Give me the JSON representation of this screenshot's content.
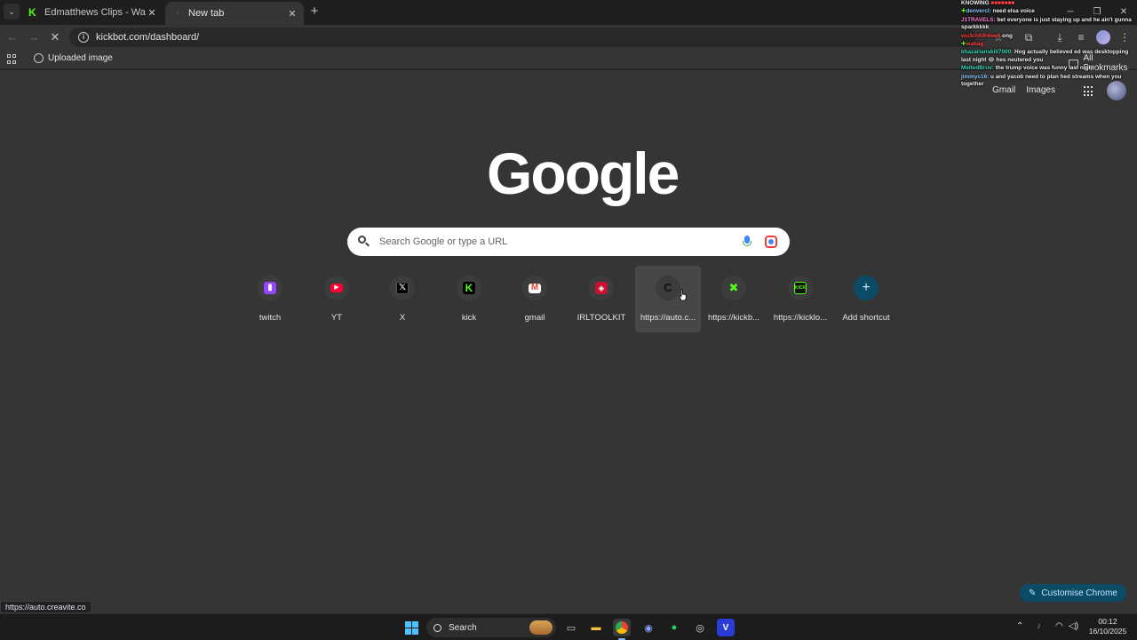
{
  "tabs": [
    {
      "title": "Edmatthews Clips - Watch Live",
      "active": false
    },
    {
      "title": "New tab",
      "active": true
    }
  ],
  "omnibox": {
    "url": "kickbot.com/dashboard/"
  },
  "bookmarks": {
    "items": [
      {
        "label": "Uploaded image"
      }
    ],
    "all_bookmarks": "All Bookmarks"
  },
  "ntp": {
    "links": [
      "Gmail",
      "Images"
    ],
    "logo_text": "Google",
    "search_placeholder": "Search Google or type a URL",
    "shortcuts": [
      {
        "label": "twitch",
        "icon": "twitch-icon"
      },
      {
        "label": "YT",
        "icon": "youtube-icon"
      },
      {
        "label": "X",
        "icon": "x-icon"
      },
      {
        "label": "kick",
        "icon": "kick-icon"
      },
      {
        "label": "gmail",
        "icon": "gmail-icon"
      },
      {
        "label": "IRLTOOLKIT",
        "icon": "irltoolkit-icon"
      },
      {
        "label": "https://auto.c...",
        "icon": "creavite-icon"
      },
      {
        "label": "https://kickb...",
        "icon": "kickbot-icon"
      },
      {
        "label": "https://kicklo...",
        "icon": "kicklogo-icon"
      },
      {
        "label": "Add shortcut",
        "icon": "plus-icon"
      }
    ],
    "customise_label": "Customise Chrome"
  },
  "status_url": "https://auto.creavite.co",
  "chat": [
    {
      "user": "KNOWING",
      "text": ""
    },
    {
      "user": "denvercl:",
      "text": "need elsa voice"
    },
    {
      "user": "J1TRAVELS:",
      "text": "bet everyone is just staying up and he ain't gunna sparkkkkk"
    },
    {
      "user": "wu3chfdh6eeb",
      "text": "ong"
    },
    {
      "user": "wabag",
      "text": ""
    },
    {
      "user": "khazarianskill7000:",
      "text": "Hog actually believed ed was desktopping last night 😂 hes neutered you"
    },
    {
      "user": "MeltedBruv:",
      "text": "the trump voice was funny last night"
    },
    {
      "user": "jimmyc16:",
      "text": "u and yacob need to plan hed streams when you together"
    }
  ],
  "taskbar": {
    "search_label": "Search",
    "time": "00:12",
    "date": "16/10/2025",
    "apps": [
      "start-icon",
      "task-view-icon",
      "file-explorer-icon",
      "chrome-icon",
      "discord-icon",
      "spotify-icon",
      "obs-icon",
      "vscode-icon"
    ]
  },
  "colors": {
    "ntp_background": "#353535",
    "accent": "#0b4b66",
    "kick_green": "#53fc18"
  }
}
